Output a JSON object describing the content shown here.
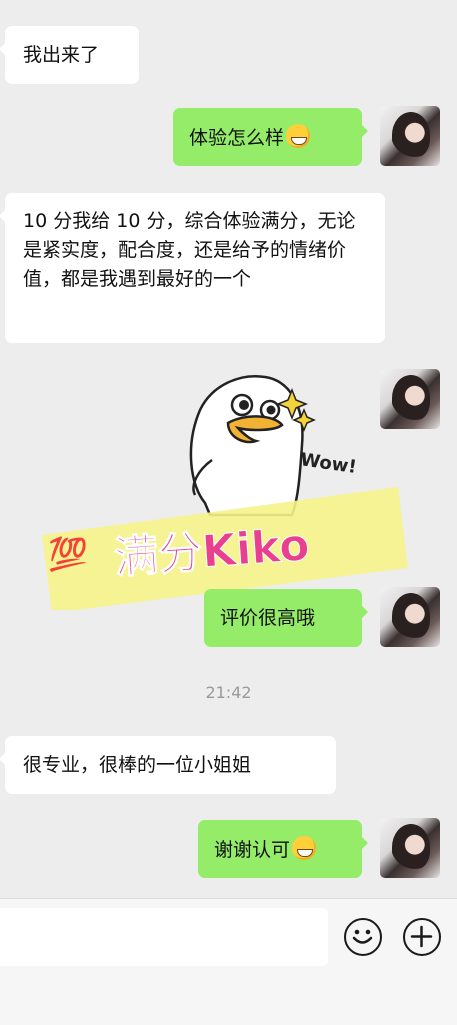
{
  "messages": {
    "m1": "我出来了",
    "m2": "体验怎么样",
    "m3": "10 分我给 10 分，综合体验满分，无论是紧实度，配合度，还是给予的情绪价值，都是我遇到最好的一个",
    "m4": "评价很高哦",
    "m5": "很专业，很棒的一位小姐姐",
    "m6": "谢谢认可"
  },
  "timestamp": "21:42",
  "sticker": {
    "wow": "Wow!",
    "hundred": "💯",
    "text": "满分Kiko"
  },
  "icons": {
    "emoji": "smiley-icon",
    "add": "plus-icon"
  },
  "colors": {
    "background": "#ededed",
    "bubble_self": "#95ec69",
    "bubble_other": "#ffffff",
    "sticker_text": "#e8408f",
    "sticker_band": "#f6f38a"
  }
}
